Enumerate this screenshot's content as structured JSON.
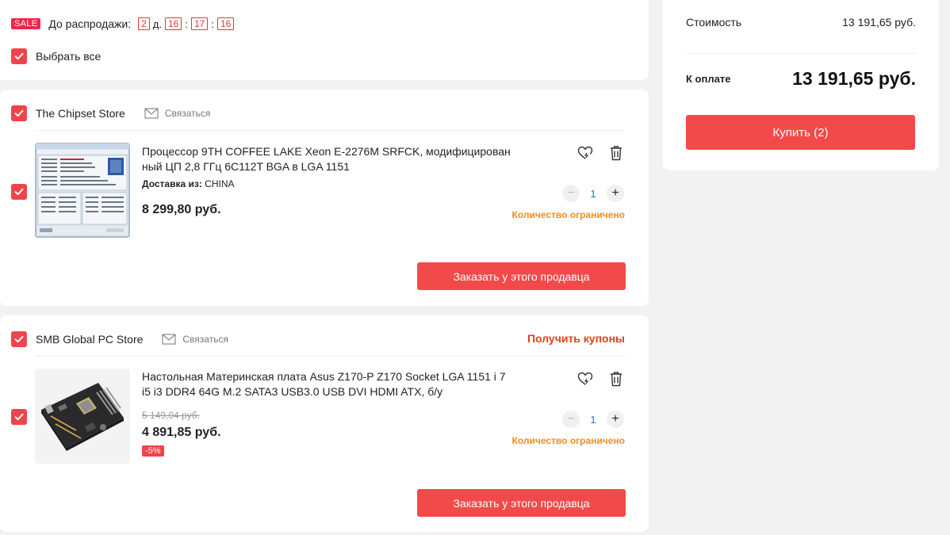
{
  "sale": {
    "badge": "SALE",
    "label": "До распродажи:",
    "days": "2",
    "days_unit": "д.",
    "hours": "16",
    "minutes": "17",
    "seconds": "16"
  },
  "select_all_label": "Выбрать все",
  "sellers": [
    {
      "name": "The Chipset Store",
      "contact_label": "Связаться",
      "item": {
        "title": "Процессор 9TH COFFEE LAKE Xeon E-2276M SRFCK, модифицирован ный ЦП 2,8 ГГц 6C112T BGA в LGA 1151",
        "delivery_label": "Доставка из:",
        "delivery_value": "CHINA",
        "price": "8 299,80 руб.",
        "quantity": "1",
        "limited_label": "Количество ограничено"
      },
      "order_button": "Заказать у этого продавца"
    },
    {
      "name": "SMB Global PC Store",
      "contact_label": "Связаться",
      "coupons_label": "Получить купоны",
      "item": {
        "title": "Настольная Материнская плата Asus Z170-P Z170 Socket LGA 1151 i 7 i5 i3 DDR4 64G M.2 SATA3 USB3.0 USB DVI HDMI ATX, б/у",
        "old_price": "5 149,04 руб.",
        "price": "4 891,85 руб.",
        "discount": "-5%",
        "quantity": "1",
        "limited_label": "Количество ограничено"
      },
      "order_button": "Заказать у этого продавца"
    }
  ],
  "summary": {
    "cost_label": "Стоимость",
    "cost_value": "13 191,65 руб.",
    "pay_label": "К оплате",
    "pay_value": "13 191,65 руб.",
    "buy_button": "Купить (2)"
  },
  "colors": {
    "accent": "#f24a4a",
    "sale_badge": "#f0274b",
    "limited": "#f28c1b",
    "coupons": "#e43f1f"
  },
  "icons": [
    "check-icon",
    "envelope-icon",
    "heart-icon",
    "trash-icon",
    "minus-icon",
    "plus-icon"
  ]
}
